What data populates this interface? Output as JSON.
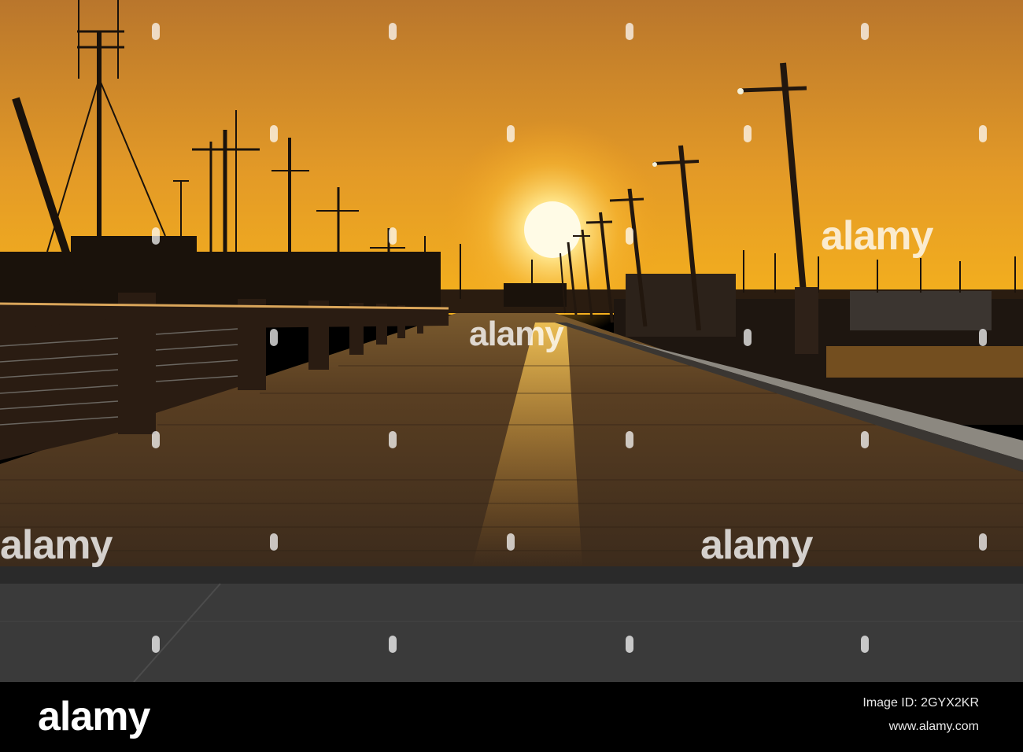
{
  "watermark": {
    "text": "alamy"
  },
  "footer": {
    "logo": "alamy",
    "image_id": "Image ID: 2GYX2KR",
    "site": "www.alamy.com"
  },
  "colors": {
    "sky_top": "#c9852e",
    "sky_horizon": "#f2a521",
    "sun": "#fff6c8",
    "boardwalk": "#4a3420",
    "silhouette": "#1a120b"
  }
}
